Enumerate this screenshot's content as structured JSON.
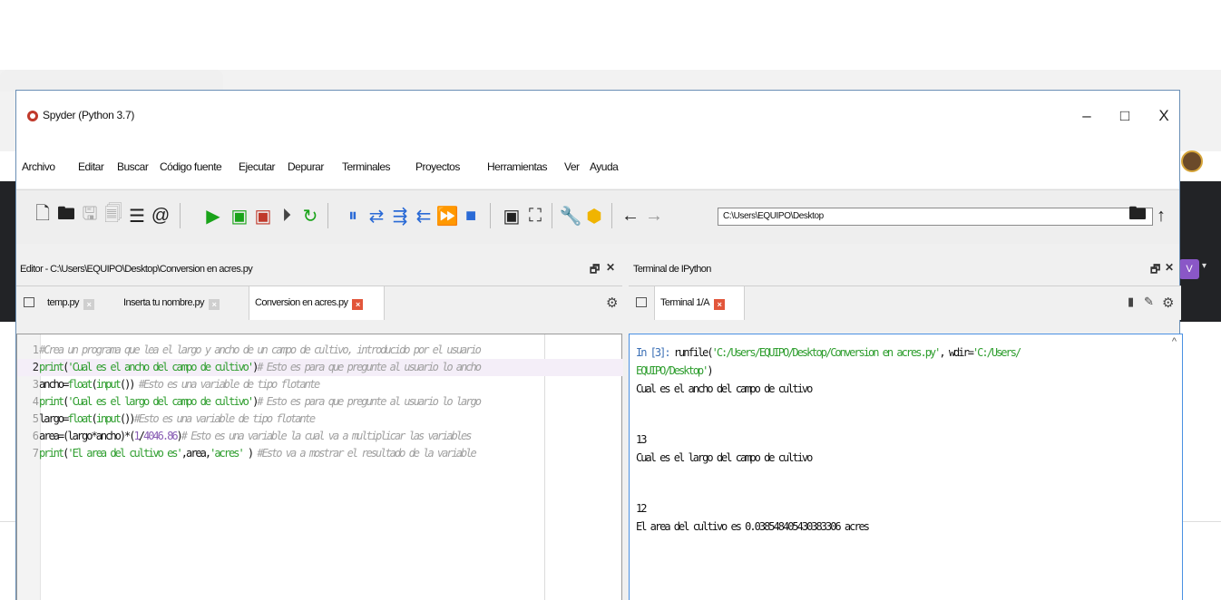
{
  "window": {
    "title": "Spyder (Python 3.7)",
    "min": "–",
    "max": "□",
    "close": "X"
  },
  "menu": [
    "Archivo",
    "Editar",
    "Buscar",
    "Código fuente",
    "Ejecutar",
    "Depurar",
    "Terminales",
    "Proyectos",
    "Herramientas",
    "Ver",
    "Ayuda"
  ],
  "toolbar": {
    "working_dir": "C:\\Users\\EQUIPO\\Desktop"
  },
  "editor": {
    "title": "Editor - C:\\Users\\EQUIPO\\Desktop\\Conversion en acres.py",
    "tabs": [
      "temp.py",
      "Inserta tu nombre.py",
      "Conversion en acres.py"
    ],
    "lines": [
      {
        "n": "1",
        "parts": [
          [
            "cm",
            "#Crea un programa que lea el largo y ancho de un campo de cultivo, introducido por el usuario"
          ]
        ]
      },
      {
        "n": "2",
        "parts": [
          [
            "kw",
            "print"
          ],
          [
            "",
            "("
          ],
          [
            "st",
            "'Cual es el ancho del campo de cultivo'"
          ],
          [
            "",
            ")"
          ],
          [
            "cm",
            "# Esto es para que pregunte al usuario lo ancho"
          ]
        ]
      },
      {
        "n": "3",
        "parts": [
          [
            "",
            "ancho="
          ],
          [
            "kw",
            "float"
          ],
          [
            "",
            "("
          ],
          [
            "kw",
            "input"
          ],
          [
            "",
            "()) "
          ],
          [
            "cm",
            "#Esto es una variable de tipo flotante"
          ]
        ]
      },
      {
        "n": "4",
        "parts": [
          [
            "kw",
            "print"
          ],
          [
            "",
            "("
          ],
          [
            "st",
            "'Cual es el largo del campo de cultivo'"
          ],
          [
            "",
            ")"
          ],
          [
            "cm",
            "# Esto es para que pregunte al usuario lo largo"
          ]
        ]
      },
      {
        "n": "5",
        "parts": [
          [
            "",
            "largo="
          ],
          [
            "kw",
            "float"
          ],
          [
            "",
            "("
          ],
          [
            "kw",
            "input"
          ],
          [
            "",
            "())"
          ],
          [
            "cm",
            "#Esto es una variable de tipo flotante"
          ]
        ]
      },
      {
        "n": "6",
        "parts": [
          [
            "",
            "area=(largo*ancho)*("
          ],
          [
            "nm",
            "1"
          ],
          [
            "",
            "/"
          ],
          [
            "nm",
            "4046.86"
          ],
          [
            "",
            ")"
          ],
          [
            "cm",
            "# Esto es una variable la cual va a multiplicar las variables"
          ]
        ]
      },
      {
        "n": "7",
        "parts": [
          [
            "kw",
            "print"
          ],
          [
            "",
            "("
          ],
          [
            "st",
            "'El area del cultivo es'"
          ],
          [
            "",
            ",area,"
          ],
          [
            "st",
            "'acres'"
          ],
          [
            "",
            " ) "
          ],
          [
            "cm",
            "#Esto va a mostrar el resultado de la variable"
          ]
        ]
      }
    ]
  },
  "console": {
    "title": "Terminal de IPython",
    "tab": "Terminal 1/A",
    "lines": [
      {
        "cls": "",
        "parts": [
          [
            "prompt",
            "In [3]: "
          ],
          [
            "",
            "runfile("
          ],
          [
            "st",
            "'C:/Users/EQUIPO/Desktop/Conversion en acres.py'"
          ],
          [
            "",
            ", wdir="
          ],
          [
            "st",
            "'C:/Users/"
          ]
        ]
      },
      {
        "cls": "",
        "parts": [
          [
            "st",
            "EQUIPO/Desktop'"
          ],
          [
            "",
            ")"
          ]
        ]
      },
      {
        "cls": "",
        "parts": [
          [
            "",
            "Cual es el ancho del campo de cultivo"
          ]
        ]
      },
      {
        "cls": "blank",
        "parts": []
      },
      {
        "cls": "",
        "parts": [
          [
            "",
            "13"
          ]
        ]
      },
      {
        "cls": "",
        "parts": [
          [
            "",
            "Cual es el largo del campo de cultivo"
          ]
        ]
      },
      {
        "cls": "blank",
        "parts": []
      },
      {
        "cls": "",
        "parts": [
          [
            "",
            "12"
          ]
        ]
      },
      {
        "cls": "",
        "parts": [
          [
            "",
            "El area del cultivo es 0.038548405430383306 acres"
          ]
        ]
      }
    ]
  }
}
